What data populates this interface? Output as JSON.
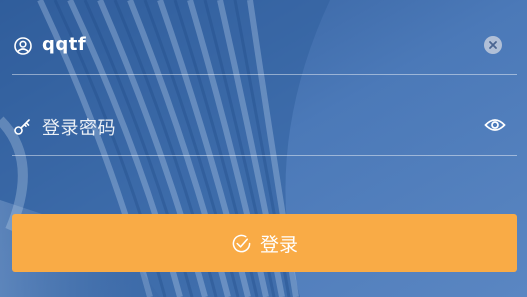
{
  "colors": {
    "background": "#4272b0",
    "login_button": "#f9ab46",
    "text": "#ffffff",
    "divider": "rgba(255,255,255,0.45)"
  },
  "username": {
    "icon": "user-icon",
    "value": "qqtf",
    "clear_icon": "clear-icon"
  },
  "password": {
    "icon": "key-icon",
    "placeholder": "登录密码",
    "toggle_icon": "eye-icon"
  },
  "login_button": {
    "icon": "check-circle-icon",
    "label": "登录"
  }
}
